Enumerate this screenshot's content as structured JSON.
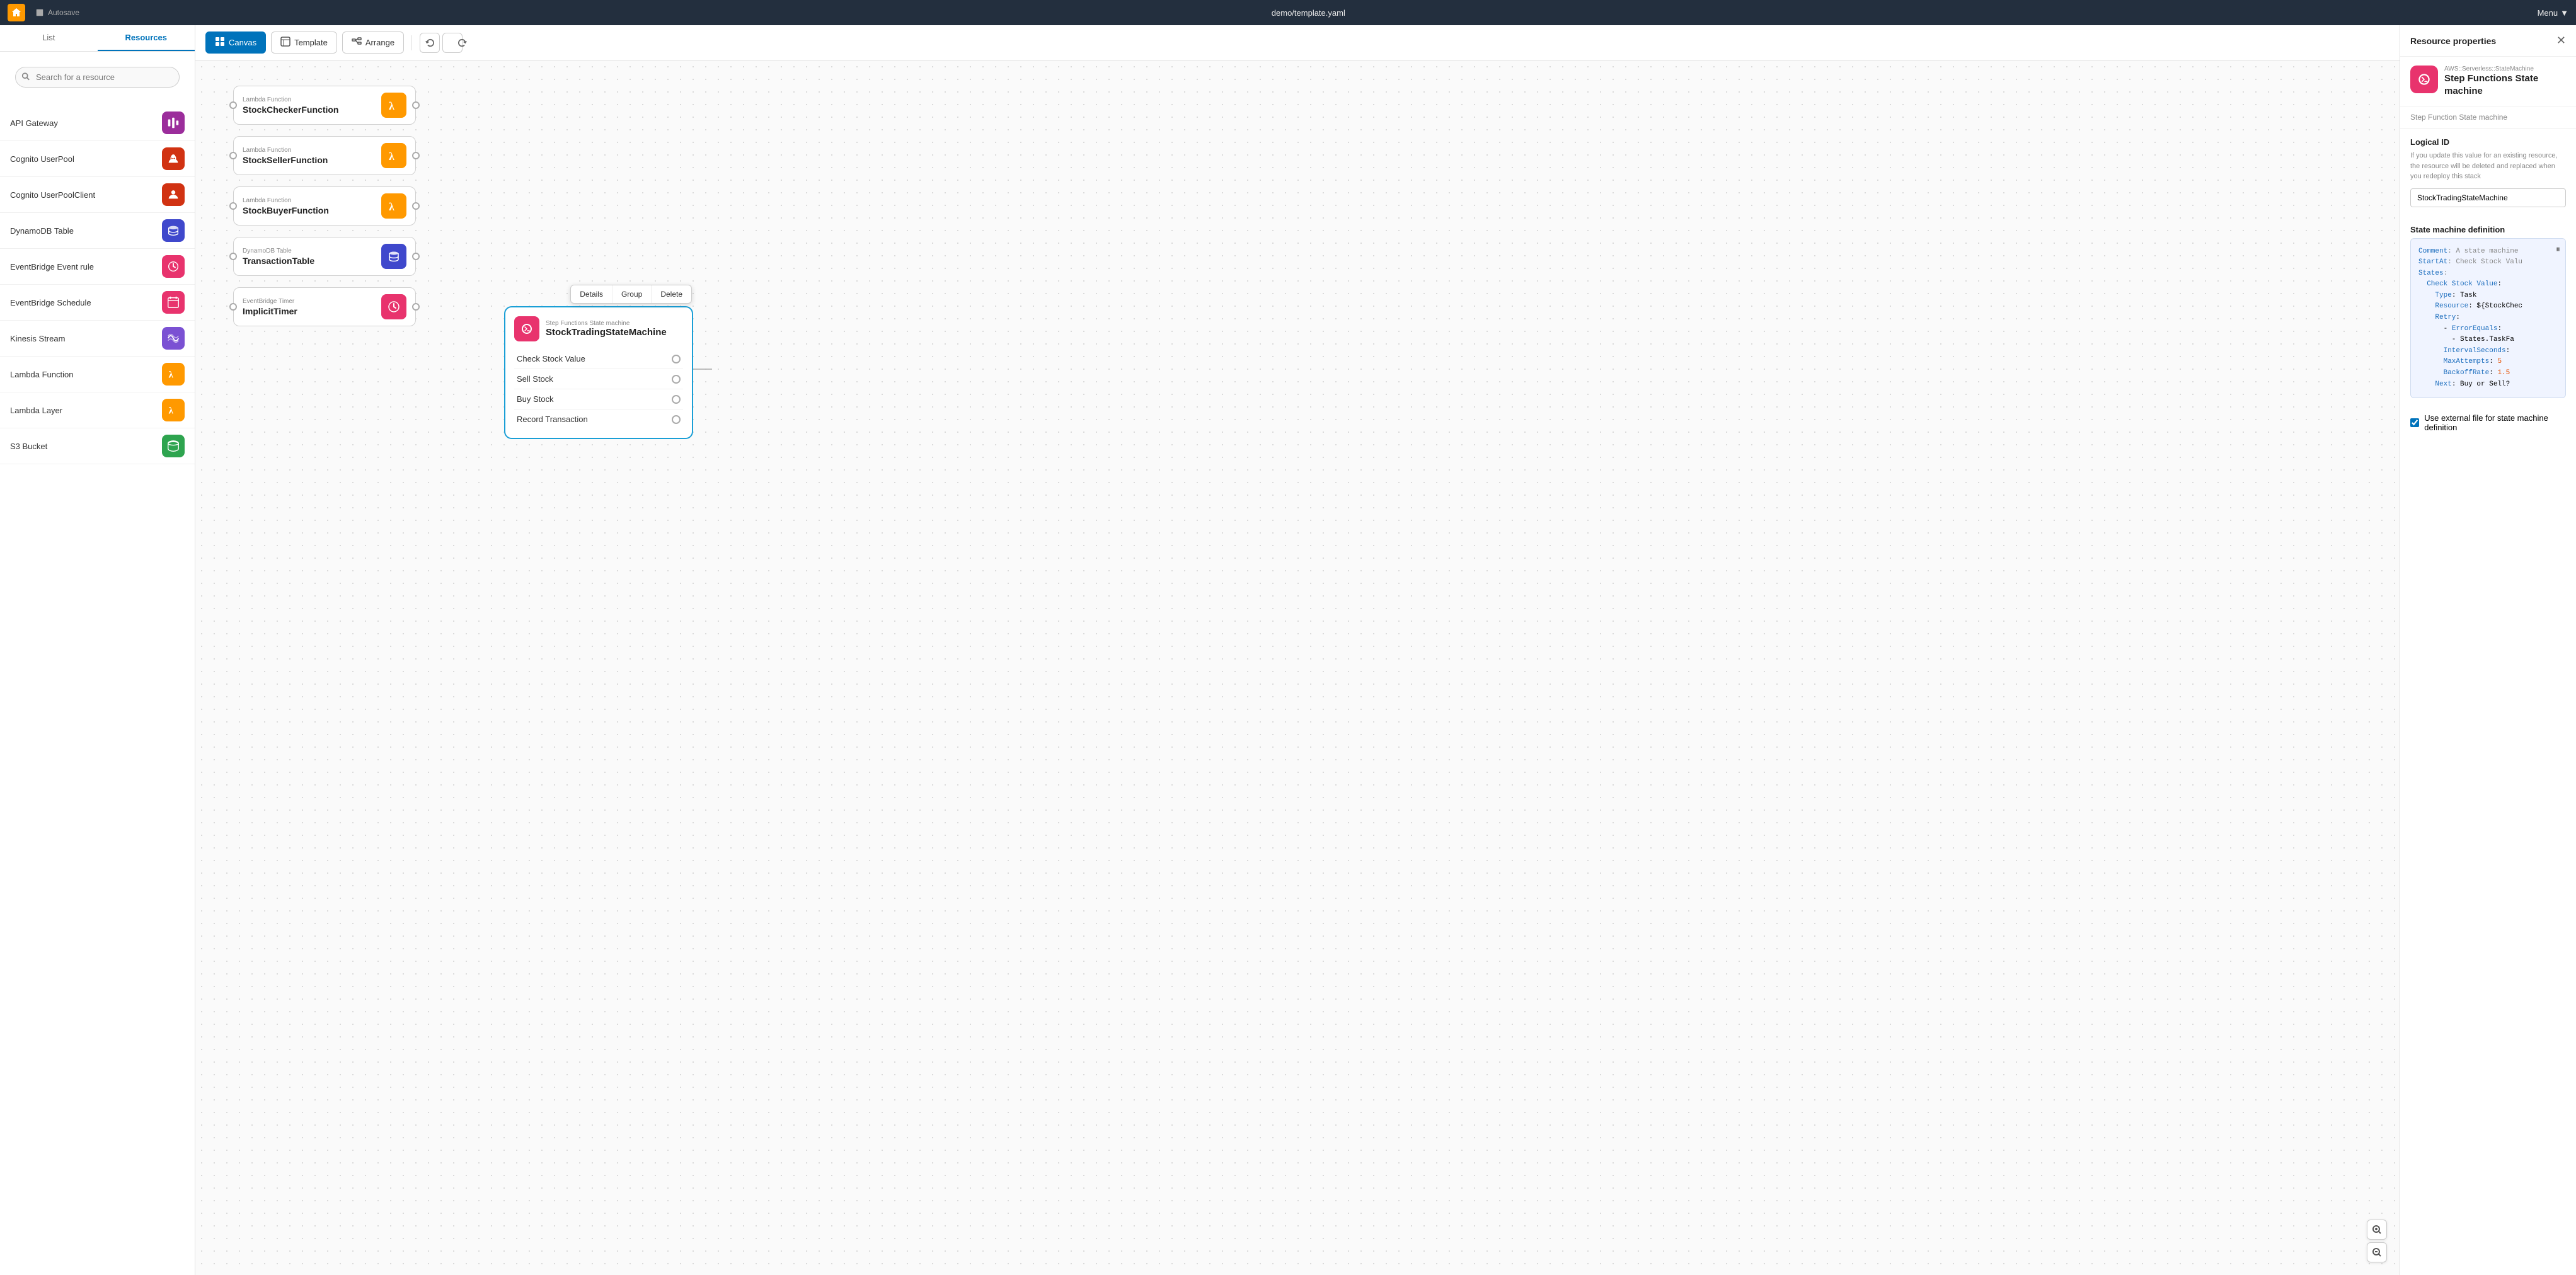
{
  "topbar": {
    "home_label": "Home",
    "autosave_label": "Autosave",
    "title": "demo/template.yaml",
    "menu_label": "Menu"
  },
  "sidebar": {
    "tab_list": "List",
    "tab_resources": "Resources",
    "search_placeholder": "Search for a resource",
    "resources": [
      {
        "id": "api-gateway",
        "label": "API Gateway",
        "icon_color": "#9b2d9b",
        "icon": "api"
      },
      {
        "id": "cognito-userpool",
        "label": "Cognito UserPool",
        "icon_color": "#d13212",
        "icon": "cognito"
      },
      {
        "id": "cognito-userpoolclient",
        "label": "Cognito UserPoolClient",
        "icon_color": "#d13212",
        "icon": "cognito"
      },
      {
        "id": "dynamodb-table",
        "label": "DynamoDB Table",
        "icon_color": "#3f48cc",
        "icon": "dynamo"
      },
      {
        "id": "eventbridge-event-rule",
        "label": "EventBridge Event rule",
        "icon_color": "#e8336d",
        "icon": "event"
      },
      {
        "id": "eventbridge-schedule",
        "label": "EventBridge Schedule",
        "icon_color": "#e8336d",
        "icon": "schedule"
      },
      {
        "id": "kinesis-stream",
        "label": "Kinesis Stream",
        "icon_color": "#7b51d3",
        "icon": "kinesis"
      },
      {
        "id": "lambda-function",
        "label": "Lambda Function",
        "icon_color": "#f90",
        "icon": "lambda"
      },
      {
        "id": "lambda-layer",
        "label": "Lambda Layer",
        "icon_color": "#f90",
        "icon": "lambda"
      },
      {
        "id": "s3-bucket",
        "label": "S3 Bucket",
        "icon_color": "#2ea44f",
        "icon": "s3"
      }
    ]
  },
  "toolbar": {
    "canvas_label": "Canvas",
    "template_label": "Template",
    "arrange_label": "Arrange",
    "undo_label": "Undo",
    "redo_label": "Redo"
  },
  "canvas": {
    "nodes": [
      {
        "id": "stock-checker",
        "type_label": "Lambda Function",
        "name": "StockCheckerFunction",
        "icon_color": "#f90"
      },
      {
        "id": "stock-seller",
        "type_label": "Lambda Function",
        "name": "StockSellerFunction",
        "icon_color": "#f90"
      },
      {
        "id": "stock-buyer",
        "type_label": "Lambda Function",
        "name": "StockBuyerFunction",
        "icon_color": "#f90"
      },
      {
        "id": "transaction-table",
        "type_label": "DynamoDB Table",
        "name": "TransactionTable",
        "icon_color": "#3f48cc"
      },
      {
        "id": "implicit-timer",
        "type_label": "EventBridge Timer",
        "name": "ImplicitTimer",
        "icon_color": "#e8336d"
      }
    ],
    "sf_machine": {
      "type_label": "Step Functions State machine",
      "name": "StockTradingStateMachine",
      "icon_color": "#e8336d",
      "states": [
        "Check Stock Value",
        "Sell Stock",
        "Buy Stock",
        "Record Transaction"
      ],
      "context_menu": {
        "details": "Details",
        "group": "Group",
        "delete": "Delete"
      }
    }
  },
  "right_panel": {
    "title": "Resource properties",
    "resource_type": "AWS::Serverless::StateMachine",
    "resource_name": "Step Functions State machine",
    "resource_desc": "Step Function State machine",
    "logical_id_label": "Logical ID",
    "logical_id_desc": "If you update this value for an existing resource, the resource will be deleted and replaced when you redeploy this stack",
    "logical_id_value": "StockTradingStateMachine",
    "state_def_label": "State machine definition",
    "code_lines": [
      {
        "key": "Comment",
        "value": ": A state machine"
      },
      {
        "key": "StartAt",
        "value": ": Check Stock Valu"
      },
      {
        "key": "States",
        "value": ":"
      },
      {
        "key": "  Check Stock Value",
        "value": ":"
      },
      {
        "key": "    Type",
        "value": ": Task"
      },
      {
        "key": "    Resource",
        "value": ": ${StockChec"
      },
      {
        "key": "    Retry",
        "value": ":"
      },
      {
        "key": "      - ErrorEquals",
        "value": ":"
      },
      {
        "key": "        - States.TaskFa",
        "value": ""
      },
      {
        "key": "      IntervalSeconds",
        "value": ":"
      },
      {
        "key": "      MaxAttempts",
        "value": ": 5"
      },
      {
        "key": "      BackoffRate",
        "value": ": 1.5"
      },
      {
        "key": "    Next",
        "value": ": Buy or Sell?"
      }
    ],
    "external_file_label": "Use external file for state machine definition",
    "checkbox_checked": true
  }
}
